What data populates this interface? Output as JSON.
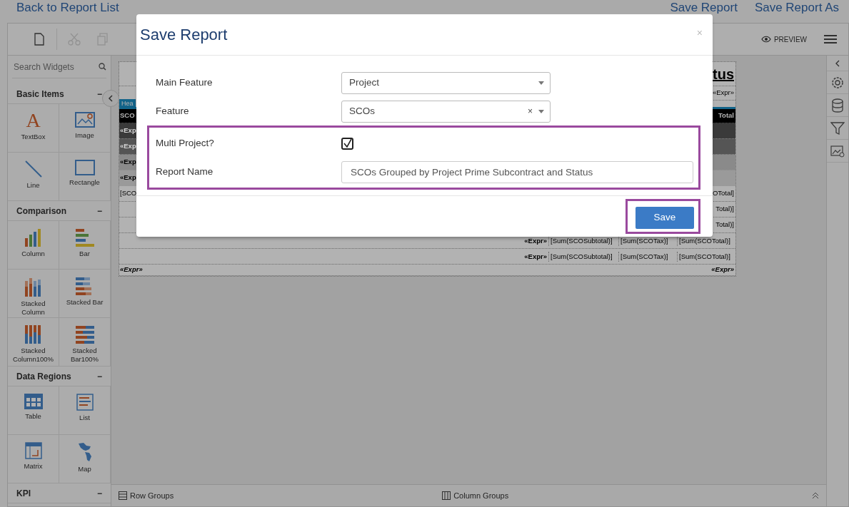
{
  "header": {
    "back_link": "Back to Report List",
    "actions": [
      {
        "label": "Save Report"
      },
      {
        "label": "Save Report As"
      }
    ]
  },
  "toolbar": {
    "tools": [
      {
        "kind": "new",
        "disabled": false
      },
      {
        "kind": "cut",
        "disabled": true
      },
      {
        "kind": "copy",
        "disabled": true
      }
    ],
    "preview": "PREVIEW"
  },
  "widgets": {
    "search_placeholder": "Search Widgets",
    "groups": [
      {
        "title": "Basic Items",
        "toggle": "−",
        "items": [
          {
            "label": "TextBox",
            "kind": "textbox",
            "glyph": "A"
          },
          {
            "label": "Image",
            "kind": "image"
          },
          {
            "label": "Line",
            "kind": "line"
          },
          {
            "label": "Rectangle",
            "kind": "rectangle"
          }
        ]
      },
      {
        "title": "Comparison",
        "toggle": "−",
        "items": [
          {
            "label": "Column",
            "kind": "column"
          },
          {
            "label": "Bar",
            "kind": "bar"
          },
          {
            "label": "Stacked Column",
            "kind": "stackedcolumn"
          },
          {
            "label": "Stacked Bar",
            "kind": "stackedbar"
          },
          {
            "label": "Stacked Column100%",
            "kind": "stackedcolumn100"
          },
          {
            "label": "Stacked Bar100%",
            "kind": "stackedbar100"
          }
        ]
      },
      {
        "title": "Data Regions",
        "toggle": "−",
        "items": [
          {
            "label": "Table",
            "kind": "table"
          },
          {
            "label": "List",
            "kind": "list"
          },
          {
            "label": "Matrix",
            "kind": "matrix"
          },
          {
            "label": "Map",
            "kind": "map"
          }
        ]
      },
      {
        "title": "KPI",
        "toggle": "−"
      }
    ]
  },
  "report": {
    "rows": [
      {
        "kind": "title",
        "right": "tus"
      },
      {
        "kind": "subtitle",
        "right": "«Expr»"
      },
      {
        "kind": "band",
        "left": "Hea"
      },
      {
        "kind": "header",
        "left": "SCO",
        "right": "Total"
      },
      {
        "kind": "group",
        "color": "#3a3a3a",
        "left": "«Exp"
      },
      {
        "kind": "group",
        "color": "#555555",
        "left": "«Exp"
      },
      {
        "kind": "group",
        "color": "#8a8a8a",
        "left": "«Exp"
      },
      {
        "kind": "group",
        "color": "#9a9a9a",
        "left": "«Exp"
      },
      {
        "kind": "detail",
        "left": "[SCO",
        "right": "OTotal]"
      },
      {
        "kind": "detail",
        "right": "Total)]"
      },
      {
        "kind": "detail",
        "right": "Total)]"
      },
      {
        "kind": "sum",
        "cells": [
          "«Expr»",
          "[Sum(SCOSubtotal)]",
          "[Sum(SCOTax)]",
          "[Sum(SCOTotal)]"
        ]
      },
      {
        "kind": "sum",
        "cells": [
          "«Expr»",
          "[Sum(SCOSubtotal)]",
          "[Sum(SCOTax)]",
          "[Sum(SCOTotal)]"
        ]
      },
      {
        "kind": "footer",
        "left": "«Expr»",
        "right": "«Expr»"
      }
    ]
  },
  "right_panel": {
    "tools": [
      {
        "kind": "settings"
      },
      {
        "kind": "data"
      },
      {
        "kind": "filter"
      },
      {
        "kind": "image"
      }
    ]
  },
  "bottom_bar": {
    "row_groups": "Row Groups",
    "column_groups": "Column Groups"
  },
  "dialog": {
    "title": "Save Report",
    "close": "×",
    "fields": [
      {
        "kind": "select",
        "label": "Main Feature",
        "value": "Project",
        "highlighted": false
      },
      {
        "kind": "select",
        "label": "Feature",
        "value": "SCOs",
        "clear": "×",
        "highlighted": false
      },
      {
        "kind": "checkbox",
        "label": "Multi Project?",
        "checked": true,
        "highlighted": true
      },
      {
        "kind": "text",
        "label": "Report Name",
        "value": "SCOs Grouped by Project Prime Subcontract and Status",
        "highlighted": true
      }
    ],
    "save": {
      "label": "Save",
      "highlighted": true
    }
  }
}
